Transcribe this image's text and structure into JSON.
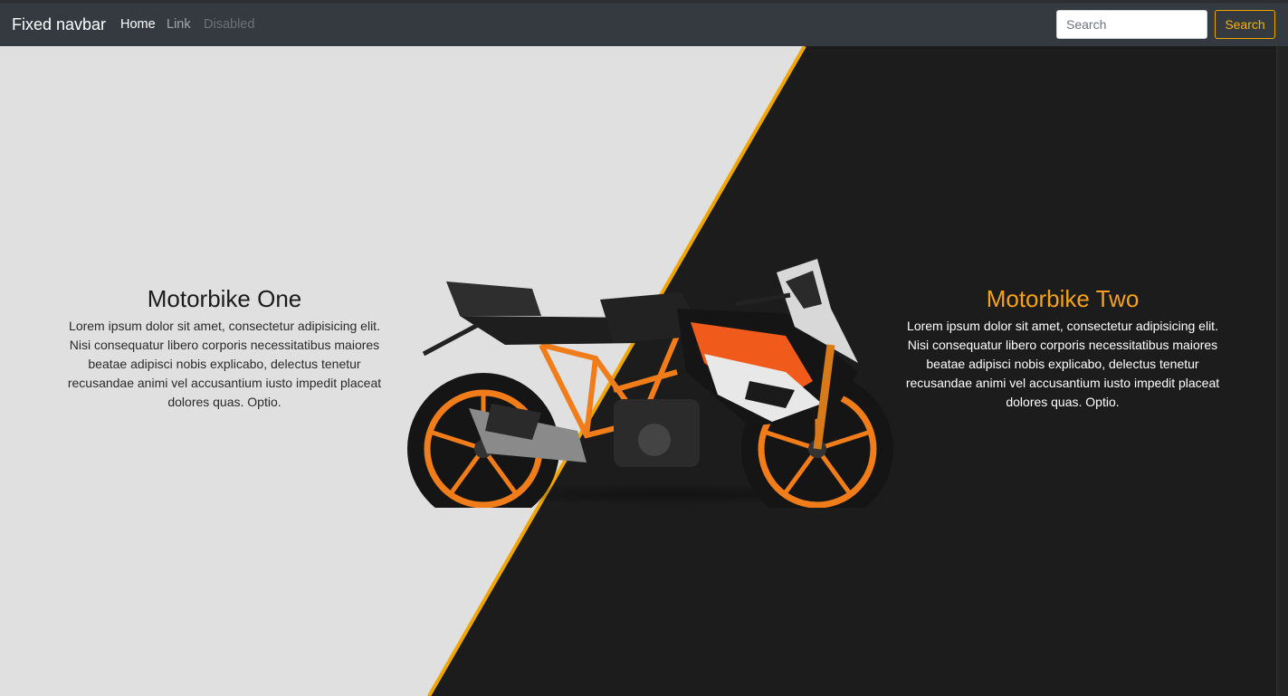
{
  "navbar": {
    "brand": "Fixed navbar",
    "links": [
      {
        "label": "Home"
      },
      {
        "label": "Link"
      },
      {
        "label": "Disabled"
      }
    ],
    "search": {
      "placeholder": "Search",
      "button_label": "Search"
    }
  },
  "hero": {
    "left": {
      "title": "Motorbike One",
      "description": "Lorem ipsum dolor sit amet, consectetur adipisicing elit. Nisi consequatur libero corporis necessitatibus maiores beatae adipisci nobis explicabo, delectus tenetur recusandae animi vel accusantium iusto impedit placeat dolores quas. Optio."
    },
    "right": {
      "title": "Motorbike Two",
      "description": "Lorem ipsum dolor sit amet, consectetur adipisicing elit. Nisi consequatur libero corporis necessitatibus maiores beatae adipisci nobis explicabo, delectus tenetur recusandae animi vel accusantium iusto impedit placeat dolores quas. Optio."
    },
    "image": {
      "icon": "motorbike-icon"
    }
  },
  "colors": {
    "navbar_bg": "#343a40",
    "left_bg": "#e0e0e1",
    "right_bg": "#1c1c1d",
    "accent": "#f7a11a",
    "divider": "#f0a500"
  }
}
